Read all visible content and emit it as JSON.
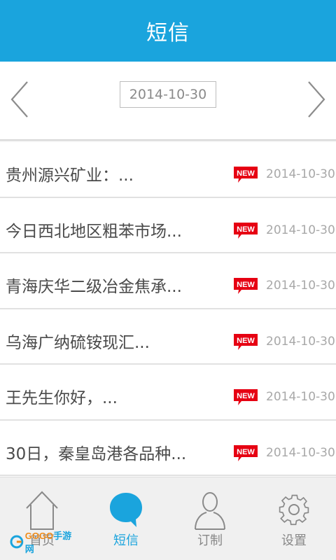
{
  "header": {
    "title": "短信"
  },
  "date_nav": {
    "prev_icon": "chevron-left-icon",
    "next_icon": "chevron-right-icon",
    "current_date": "2014-10-30"
  },
  "messages": [
    {
      "title": "贵州源兴矿业：...",
      "badge": "NEW",
      "date": "2014-10-30"
    },
    {
      "title": "今日西北地区粗苯市场...",
      "badge": "NEW",
      "date": "2014-10-30"
    },
    {
      "title": "青海庆华二级冶金焦承...",
      "badge": "NEW",
      "date": "2014-10-30"
    },
    {
      "title": "乌海广纳硫铵现汇...",
      "badge": "NEW",
      "date": "2014-10-30"
    },
    {
      "title": "王先生你好，...",
      "badge": "NEW",
      "date": "2014-10-30"
    },
    {
      "title": "30日，秦皇岛港各品种...",
      "badge": "NEW",
      "date": "2014-10-30"
    }
  ],
  "tabbar": {
    "tabs": [
      {
        "label": "首页",
        "icon": "home-icon",
        "active": false
      },
      {
        "label": "短信",
        "icon": "message-bubble-icon",
        "active": true
      },
      {
        "label": "订制",
        "icon": "person-icon",
        "active": false
      },
      {
        "label": "设置",
        "icon": "gear-icon",
        "active": false
      }
    ]
  },
  "watermark": {
    "brand_left": "GOGO",
    "brand_right": "手游网"
  },
  "colors": {
    "accent": "#1aa4dd",
    "badge_red": "#e60012",
    "text": "#4a4a4a",
    "muted": "#a8a8a8"
  }
}
